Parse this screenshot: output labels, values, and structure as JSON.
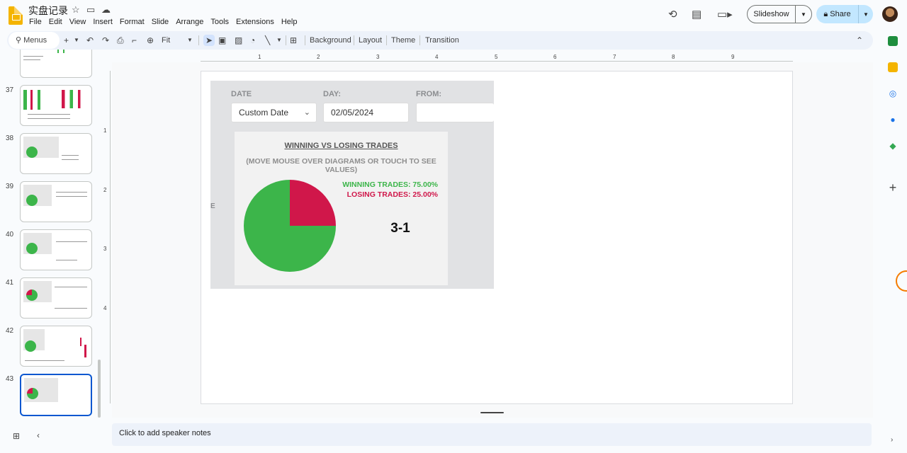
{
  "app": {
    "title": "实盘记录"
  },
  "menu": [
    "File",
    "Edit",
    "View",
    "Insert",
    "Format",
    "Slide",
    "Arrange",
    "Tools",
    "Extensions",
    "Help"
  ],
  "header": {
    "slideshow_label": "Slideshow",
    "share_label": "Share"
  },
  "toolbar": {
    "search_placeholder": "Menus",
    "zoom_label": "Fit",
    "background_label": "Background",
    "layout_label": "Layout",
    "theme_label": "Theme",
    "transition_label": "Transition"
  },
  "filmstrip": {
    "slides": [
      {
        "num": "37"
      },
      {
        "num": "38"
      },
      {
        "num": "39"
      },
      {
        "num": "40"
      },
      {
        "num": "41"
      },
      {
        "num": "42"
      },
      {
        "num": "43"
      }
    ],
    "selected": "43"
  },
  "ruler": {
    "horizontal": [
      "1",
      "2",
      "3",
      "4",
      "5",
      "6",
      "7",
      "8",
      "9"
    ],
    "vertical": [
      "1",
      "2",
      "3",
      "4"
    ]
  },
  "slide": {
    "labels": {
      "date": "DATE",
      "day": "DAY:",
      "from": "FROM:"
    },
    "date_value": "Custom Date",
    "day_value": "02/05/2024",
    "from_value": "",
    "edge_letter": "E",
    "card_title": "WINNING VS LOSING TRADES",
    "card_subtitle": "(MOVE MOUSE OVER DIAGRAMS OR TOUCH TO SEE VALUES)",
    "winning_text": "WINNING TRADES: 75.00%",
    "losing_text": "LOSING TRADES: 25.00%",
    "ratio": "3-1",
    "colors": {
      "win": "#3cb54a",
      "lose": "#d0174a"
    }
  },
  "chart_data": {
    "type": "pie",
    "categories": [
      "Winning trades",
      "Losing trades"
    ],
    "values": [
      75,
      25
    ]
  },
  "notes": {
    "placeholder": "Click to add speaker notes"
  }
}
